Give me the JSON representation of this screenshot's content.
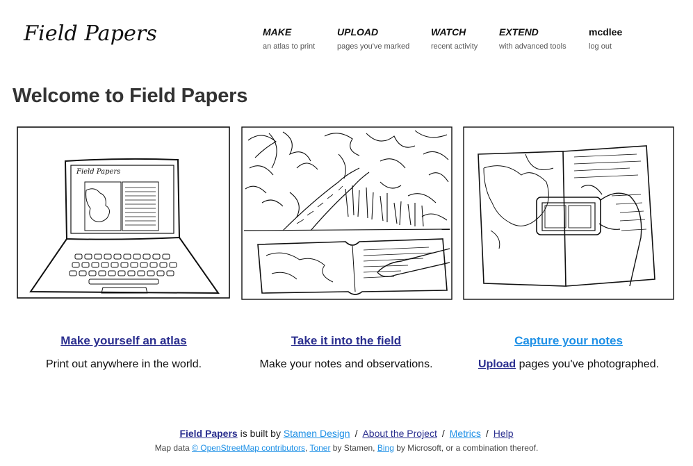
{
  "logo": {
    "text": "Field Papers"
  },
  "nav": [
    {
      "title": "MAKE",
      "sub": "an atlas to print"
    },
    {
      "title": "UPLOAD",
      "sub": "pages you've marked"
    },
    {
      "title": "WATCH",
      "sub": "recent activity"
    },
    {
      "title": "EXTEND",
      "sub": "with advanced tools"
    },
    {
      "title": "mcdlee",
      "sub": "log out"
    }
  ],
  "page_title": "Welcome to Field Papers",
  "cards": [
    {
      "link": "Make yourself an atlas",
      "desc": "Print out anywhere in the world."
    },
    {
      "link": "Take it into the field",
      "desc": "Make your notes and observations."
    },
    {
      "link": "Capture your notes",
      "desc_link": "Upload",
      "desc": " pages you've photographed."
    }
  ],
  "footer": {
    "brand": "Field Papers",
    "built_by": " is built by ",
    "stamen": "Stamen Design",
    "sep": "/",
    "about": "About the Project",
    "metrics": "Metrics",
    "help": "Help",
    "map_data_prefix": "Map data ",
    "osm": "© OpenStreetMap contributors",
    "comma": ", ",
    "toner": "Toner",
    "by_stamen": " by Stamen, ",
    "bing": "Bing",
    "suffix": " by Microsoft, or a combination thereof."
  },
  "colors": {
    "link_dark": "#2b2f8f",
    "link_light": "#1e90e6",
    "title": "#333333"
  },
  "icons": [
    "laptop-illustration",
    "field-notebook-illustration",
    "camera-capture-illustration"
  ]
}
